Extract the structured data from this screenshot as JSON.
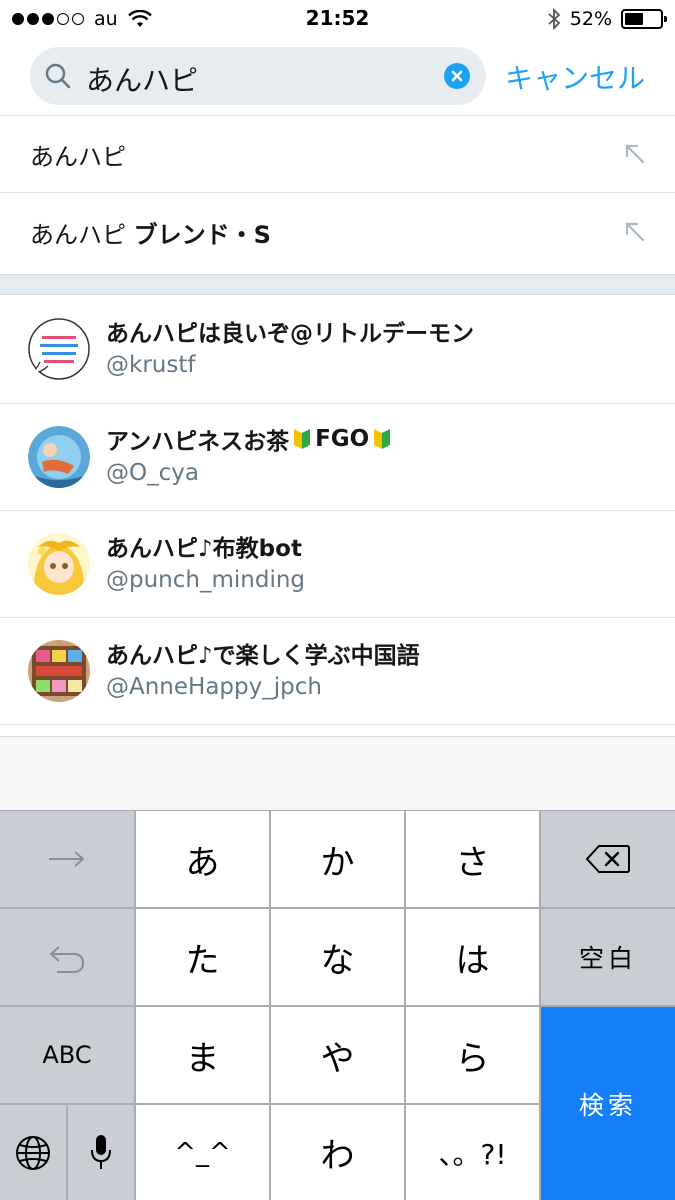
{
  "status_bar": {
    "carrier": "au",
    "time": "21:52",
    "battery_percent": "52%",
    "battery_level": 0.52,
    "signal_bars_filled": 3,
    "signal_bars_total": 5
  },
  "search": {
    "query": "あんハピ",
    "cancel_label": "キャンセル",
    "accent_color": "#1da1f2"
  },
  "suggestions": [
    {
      "prefix": "あんハピ",
      "bold": ""
    },
    {
      "prefix": "あんハピ ",
      "bold": "ブレンド・S"
    }
  ],
  "users": [
    {
      "name": "あんハピは良いぞ@リトルデーモン",
      "handle": "@krustf"
    },
    {
      "name_parts": [
        "アンハピネスお茶",
        "FGO"
      ],
      "handle": "@O_cya"
    },
    {
      "name": "あんハピ♪布教bot",
      "handle": "@punch_minding"
    },
    {
      "name": "あんハピ♪で楽しく学ぶ中国語",
      "handle": "@AnneHappy_jpch"
    }
  ],
  "keyboard": {
    "row1": [
      "あ",
      "か",
      "さ"
    ],
    "row2": [
      "た",
      "な",
      "は"
    ],
    "row3": [
      "ま",
      "や",
      "ら"
    ],
    "row4": [
      "^_^",
      "わ",
      "、。?!"
    ],
    "space_label": "空白",
    "abc_label": "ABC",
    "search_label": "検索",
    "icons": [
      "arrow-right-icon",
      "undo-icon",
      "globe-icon",
      "microphone-icon",
      "delete-icon"
    ]
  }
}
